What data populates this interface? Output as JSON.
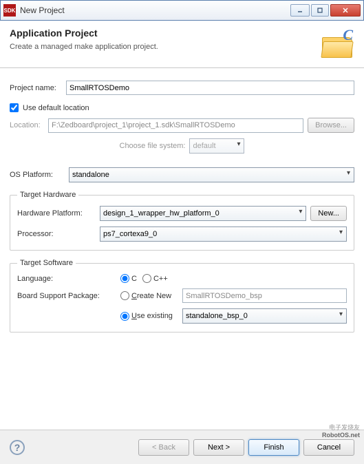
{
  "window": {
    "title": "New Project"
  },
  "banner": {
    "heading": "Application Project",
    "desc": "Create a managed make application project."
  },
  "form": {
    "project_name_label": "Project name:",
    "project_name_value": "SmallRTOSDemo",
    "use_default_label_pre": "Use ",
    "use_default_label_u": "d",
    "use_default_label_post": "efault location",
    "use_default_checked": true,
    "location_label": "Location:",
    "location_value": "F:\\Zedboard\\project_1\\project_1.sdk\\SmallRTOSDemo",
    "browse_label": "Browse...",
    "choose_fs_label": "Choose file system:",
    "choose_fs_value": "default",
    "os_platform_label": "OS Platform:",
    "os_platform_value": "standalone"
  },
  "hw": {
    "legend": "Target Hardware",
    "platform_label": "Hardware Platform:",
    "platform_value": "design_1_wrapper_hw_platform_0",
    "new_label": "New...",
    "processor_label": "Processor:",
    "processor_value": "ps7_cortexa9_0"
  },
  "sw": {
    "legend": "Target Software",
    "language_label": "Language:",
    "lang_c": "C",
    "lang_cpp": "C++",
    "lang_selected": "c",
    "bsp_label": "Board Support Package:",
    "create_new_label_u": "C",
    "create_new_label_post": "reate New",
    "create_new_value": "SmallRTOSDemo_bsp",
    "use_existing_label_u": "U",
    "use_existing_label_post": "se existing",
    "use_existing_value": "standalone_bsp_0",
    "bsp_mode": "existing"
  },
  "nav": {
    "back": "< Back",
    "next": "Next >",
    "finish": "Finish",
    "cancel": "Cancel"
  },
  "watermark": {
    "l1": "电子发烧友",
    "l2": "RobotOS.net"
  }
}
